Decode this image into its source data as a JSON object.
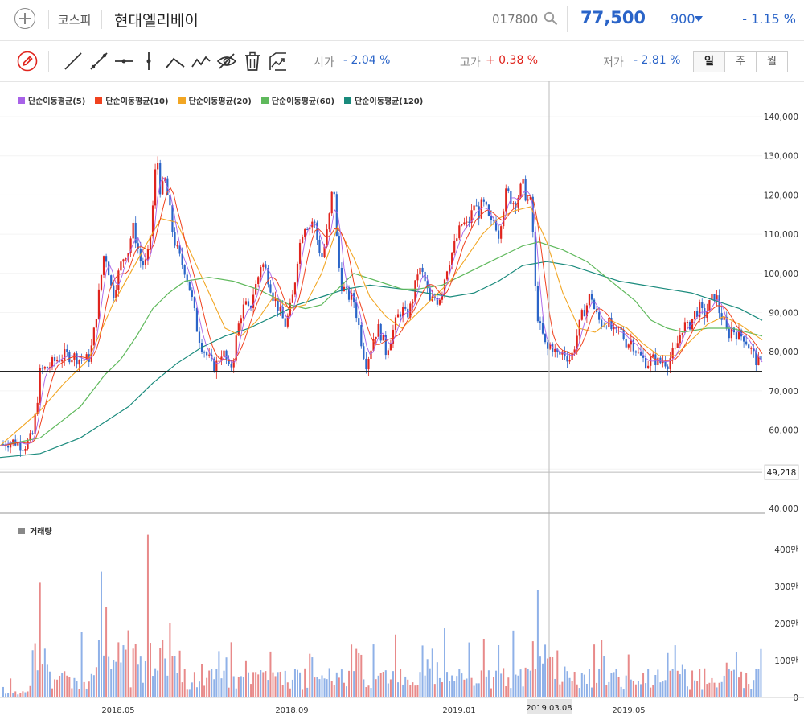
{
  "header": {
    "market": "코스피",
    "name": "현대엘리베이",
    "code": "017800",
    "price": "77,500",
    "change": "900",
    "change_pct": "- 1.15 %",
    "accent": "#2a64c8",
    "up": "#e0241d"
  },
  "toolbar": {
    "tools": [
      "pencil-icon",
      "line-icon",
      "ray-icon",
      "horizontal-line-icon",
      "vertical-line-icon",
      "wedge-icon",
      "polyline-icon",
      "hide-icon",
      "trash-icon",
      "export-icon"
    ]
  },
  "quote": {
    "open_label": "시가",
    "open_value": "- 2.04 %",
    "high_label": "고가",
    "high_value": "+ 0.38 %",
    "low_label": "저가",
    "low_value": "- 2.81 %"
  },
  "period": {
    "day": "일",
    "week": "주",
    "month": "월"
  },
  "legend": [
    {
      "label": "단순이동평균(5)",
      "color": "#a862e8"
    },
    {
      "label": "단순이동평균(10)",
      "color": "#f0421f"
    },
    {
      "label": "단순이동평균(20)",
      "color": "#f2a623"
    },
    {
      "label": "단순이동평균(60)",
      "color": "#5fb95c"
    },
    {
      "label": "단순이동평균(120)",
      "color": "#198a7c"
    }
  ],
  "volume_label": "거래량",
  "crosshair": {
    "price_label": "49,218",
    "date_label": "2019.03.08"
  },
  "chart_data": {
    "type": "candlestick",
    "price_axis": {
      "ticks": [
        140000,
        130000,
        120000,
        110000,
        100000,
        90000,
        80000,
        70000,
        60000,
        50000,
        40000
      ],
      "tick_labels": [
        "140,000",
        "130,000",
        "120,000",
        "110,000",
        "100,000",
        "90,000",
        "80,000",
        "70,000",
        "60,000",
        "50,000",
        "40,000"
      ],
      "range": [
        40000,
        142000
      ]
    },
    "volume_axis": {
      "ticks": [
        400,
        300,
        200,
        100,
        0
      ],
      "tick_labels": [
        "400만",
        "300만",
        "200만",
        "100만",
        "0"
      ],
      "unit": "만",
      "range": [
        0,
        440
      ]
    },
    "x_labels": [
      "2018.05",
      "2018.09",
      "2019.01",
      "2019.05"
    ],
    "reference_line": 75000,
    "crosshair_date": "2019.03.08",
    "close_path": [
      [
        0,
        56000
      ],
      [
        10,
        57000
      ],
      [
        20,
        57000
      ],
      [
        30,
        56000
      ],
      [
        40,
        58000
      ],
      [
        45,
        65000
      ],
      [
        50,
        75000
      ],
      [
        60,
        76000
      ],
      [
        70,
        78000
      ],
      [
        80,
        79000
      ],
      [
        90,
        79000
      ],
      [
        100,
        78000
      ],
      [
        110,
        78000
      ],
      [
        115,
        82000
      ],
      [
        120,
        90000
      ],
      [
        125,
        98000
      ],
      [
        130,
        106000
      ],
      [
        135,
        101000
      ],
      [
        140,
        94000
      ],
      [
        145,
        98000
      ],
      [
        150,
        102000
      ],
      [
        155,
        105000
      ],
      [
        160,
        106000
      ],
      [
        165,
        112000
      ],
      [
        170,
        108000
      ],
      [
        175,
        103000
      ],
      [
        180,
        102000
      ],
      [
        185,
        105000
      ],
      [
        190,
        117000
      ],
      [
        195,
        131000
      ],
      [
        200,
        120000
      ],
      [
        205,
        124000
      ],
      [
        210,
        118000
      ],
      [
        215,
        110000
      ],
      [
        220,
        106000
      ],
      [
        225,
        103000
      ],
      [
        230,
        101000
      ],
      [
        235,
        97000
      ],
      [
        240,
        92000
      ],
      [
        245,
        86000
      ],
      [
        250,
        82000
      ],
      [
        255,
        80000
      ],
      [
        260,
        78000
      ],
      [
        265,
        76000
      ],
      [
        270,
        77000
      ],
      [
        275,
        80000
      ],
      [
        280,
        79000
      ],
      [
        285,
        75000
      ],
      [
        290,
        78000
      ],
      [
        295,
        85000
      ],
      [
        300,
        90000
      ],
      [
        305,
        92000
      ],
      [
        310,
        90000
      ],
      [
        315,
        95000
      ],
      [
        320,
        98000
      ],
      [
        325,
        103000
      ],
      [
        330,
        101000
      ],
      [
        335,
        98000
      ],
      [
        340,
        94000
      ],
      [
        345,
        92000
      ],
      [
        350,
        89000
      ],
      [
        355,
        87000
      ],
      [
        360,
        90000
      ],
      [
        365,
        95000
      ],
      [
        370,
        104000
      ],
      [
        375,
        110000
      ],
      [
        380,
        113000
      ],
      [
        385,
        112000
      ],
      [
        390,
        114000
      ],
      [
        395,
        108000
      ],
      [
        400,
        104000
      ],
      [
        405,
        108000
      ],
      [
        410,
        115000
      ],
      [
        415,
        124000
      ],
      [
        420,
        104000
      ],
      [
        425,
        97000
      ],
      [
        430,
        95000
      ],
      [
        435,
        94000
      ],
      [
        440,
        93000
      ],
      [
        445,
        88000
      ],
      [
        450,
        82000
      ],
      [
        455,
        77000
      ],
      [
        460,
        80000
      ],
      [
        465,
        84000
      ],
      [
        470,
        86000
      ],
      [
        475,
        84000
      ],
      [
        480,
        80000
      ],
      [
        485,
        83000
      ],
      [
        490,
        86000
      ],
      [
        495,
        89000
      ],
      [
        500,
        91000
      ],
      [
        505,
        89000
      ],
      [
        510,
        91000
      ],
      [
        515,
        95000
      ],
      [
        520,
        101000
      ],
      [
        525,
        100000
      ],
      [
        530,
        97000
      ],
      [
        535,
        92000
      ],
      [
        540,
        94000
      ],
      [
        545,
        93000
      ],
      [
        550,
        96000
      ],
      [
        555,
        101000
      ],
      [
        560,
        104000
      ],
      [
        565,
        107000
      ],
      [
        570,
        110000
      ],
      [
        575,
        113000
      ],
      [
        580,
        112000
      ],
      [
        585,
        114000
      ],
      [
        590,
        118000
      ],
      [
        595,
        115000
      ],
      [
        600,
        118000
      ],
      [
        605,
        116000
      ],
      [
        610,
        112000
      ],
      [
        615,
        114000
      ],
      [
        620,
        110000
      ],
      [
        625,
        116000
      ],
      [
        630,
        121000
      ],
      [
        635,
        119000
      ],
      [
        640,
        118000
      ],
      [
        645,
        120000
      ],
      [
        650,
        123000
      ],
      [
        655,
        119000
      ],
      [
        660,
        118000
      ],
      [
        663,
        110000
      ],
      [
        666,
        95000
      ],
      [
        670,
        87000
      ],
      [
        675,
        84000
      ],
      [
        680,
        80000
      ],
      [
        685,
        82000
      ],
      [
        690,
        80000
      ],
      [
        695,
        79000
      ],
      [
        700,
        80000
      ],
      [
        705,
        79000
      ],
      [
        710,
        78000
      ],
      [
        715,
        82000
      ],
      [
        720,
        86000
      ],
      [
        725,
        90000
      ],
      [
        730,
        92000
      ],
      [
        735,
        95000
      ],
      [
        740,
        90000
      ],
      [
        745,
        88000
      ],
      [
        750,
        87000
      ],
      [
        755,
        88000
      ],
      [
        760,
        86000
      ],
      [
        765,
        84000
      ],
      [
        770,
        86000
      ],
      [
        775,
        84000
      ],
      [
        780,
        82000
      ],
      [
        785,
        83000
      ],
      [
        790,
        81000
      ],
      [
        795,
        79000
      ],
      [
        800,
        78000
      ],
      [
        805,
        77000
      ],
      [
        810,
        78000
      ],
      [
        815,
        78000
      ],
      [
        820,
        77000
      ],
      [
        825,
        78000
      ],
      [
        830,
        77000
      ],
      [
        835,
        79000
      ],
      [
        840,
        80000
      ],
      [
        845,
        84000
      ],
      [
        850,
        87000
      ],
      [
        855,
        86000
      ],
      [
        860,
        88000
      ],
      [
        865,
        90000
      ],
      [
        870,
        91000
      ],
      [
        875,
        89000
      ],
      [
        880,
        91000
      ],
      [
        885,
        93000
      ],
      [
        890,
        95000
      ],
      [
        895,
        90000
      ],
      [
        900,
        88000
      ],
      [
        905,
        84000
      ],
      [
        910,
        86000
      ],
      [
        915,
        85000
      ],
      [
        920,
        84000
      ],
      [
        925,
        84000
      ],
      [
        930,
        82000
      ],
      [
        935,
        80000
      ],
      [
        940,
        78000
      ],
      [
        945,
        77000
      ],
      [
        948,
        76000
      ]
    ],
    "ma_keys": [
      {
        "name": "단순이동평균(60)",
        "points": [
          [
            0,
            56000
          ],
          [
            50,
            58000
          ],
          [
            100,
            66000
          ],
          [
            130,
            74000
          ],
          [
            150,
            78000
          ],
          [
            170,
            84000
          ],
          [
            190,
            91000
          ],
          [
            210,
            95000
          ],
          [
            230,
            98000
          ],
          [
            260,
            99000
          ],
          [
            290,
            98000
          ],
          [
            320,
            96000
          ],
          [
            340,
            94000
          ],
          [
            360,
            92000
          ],
          [
            380,
            91000
          ],
          [
            400,
            92000
          ],
          [
            420,
            96000
          ],
          [
            440,
            100000
          ],
          [
            470,
            98000
          ],
          [
            500,
            96000
          ],
          [
            520,
            96000
          ],
          [
            550,
            97000
          ],
          [
            570,
            99000
          ],
          [
            590,
            101000
          ],
          [
            620,
            104000
          ],
          [
            650,
            107000
          ],
          [
            670,
            108000
          ],
          [
            700,
            106000
          ],
          [
            730,
            103000
          ],
          [
            760,
            98000
          ],
          [
            790,
            93000
          ],
          [
            810,
            88000
          ],
          [
            830,
            86000
          ],
          [
            850,
            85000
          ],
          [
            880,
            86000
          ],
          [
            910,
            86000
          ],
          [
            948,
            84000
          ]
        ]
      },
      {
        "name": "단순이동평균(120)",
        "points": [
          [
            0,
            53000
          ],
          [
            50,
            54000
          ],
          [
            100,
            58000
          ],
          [
            130,
            62000
          ],
          [
            160,
            66000
          ],
          [
            190,
            72000
          ],
          [
            220,
            77000
          ],
          [
            250,
            81000
          ],
          [
            280,
            84000
          ],
          [
            310,
            86000
          ],
          [
            340,
            89000
          ],
          [
            370,
            92000
          ],
          [
            400,
            94000
          ],
          [
            430,
            96000
          ],
          [
            460,
            97000
          ],
          [
            500,
            96000
          ],
          [
            530,
            95000
          ],
          [
            560,
            94000
          ],
          [
            590,
            95000
          ],
          [
            620,
            98000
          ],
          [
            650,
            102000
          ],
          [
            680,
            103000
          ],
          [
            710,
            102000
          ],
          [
            740,
            100000
          ],
          [
            770,
            98000
          ],
          [
            800,
            97000
          ],
          [
            830,
            96000
          ],
          [
            860,
            95000
          ],
          [
            890,
            93000
          ],
          [
            920,
            91000
          ],
          [
            948,
            88000
          ]
        ]
      }
    ],
    "ma_20_points": [
      [
        0,
        56000
      ],
      [
        50,
        65000
      ],
      [
        80,
        72000
      ],
      [
        110,
        78000
      ],
      [
        140,
        92000
      ],
      [
        170,
        103000
      ],
      [
        200,
        114000
      ],
      [
        220,
        113000
      ],
      [
        240,
        104000
      ],
      [
        260,
        95000
      ],
      [
        280,
        86000
      ],
      [
        300,
        84000
      ],
      [
        320,
        88000
      ],
      [
        340,
        94000
      ],
      [
        360,
        91000
      ],
      [
        380,
        92000
      ],
      [
        400,
        100000
      ],
      [
        420,
        112000
      ],
      [
        440,
        104000
      ],
      [
        460,
        94000
      ],
      [
        480,
        89000
      ],
      [
        500,
        86000
      ],
      [
        520,
        90000
      ],
      [
        540,
        94000
      ],
      [
        560,
        98000
      ],
      [
        580,
        104000
      ],
      [
        600,
        110000
      ],
      [
        620,
        114000
      ],
      [
        640,
        116000
      ],
      [
        660,
        117000
      ],
      [
        680,
        108000
      ],
      [
        700,
        95000
      ],
      [
        720,
        86000
      ],
      [
        740,
        85000
      ],
      [
        760,
        88000
      ],
      [
        780,
        86000
      ],
      [
        800,
        82000
      ],
      [
        820,
        79000
      ],
      [
        840,
        79000
      ],
      [
        860,
        83000
      ],
      [
        880,
        87000
      ],
      [
        900,
        89000
      ],
      [
        920,
        87000
      ],
      [
        948,
        83000
      ]
    ]
  }
}
